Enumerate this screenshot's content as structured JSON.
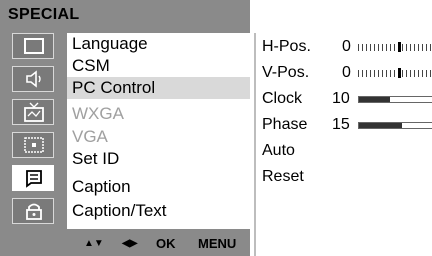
{
  "osd": {
    "title": "SPECIAL",
    "icons": [
      {
        "name": "picture-icon",
        "active": false
      },
      {
        "name": "sound-icon",
        "active": false
      },
      {
        "name": "tv-icon",
        "active": false
      },
      {
        "name": "screen-icon",
        "active": false
      },
      {
        "name": "special-icon",
        "active": true
      },
      {
        "name": "lock-icon",
        "active": false
      }
    ],
    "menu": [
      {
        "label": "Language",
        "state": "normal"
      },
      {
        "label": "CSM",
        "state": "normal"
      },
      {
        "label": "PC Control",
        "state": "selected"
      },
      {
        "label": "WXGA",
        "state": "disabled"
      },
      {
        "label": "VGA",
        "state": "disabled"
      },
      {
        "label": "Set ID",
        "state": "normal"
      },
      {
        "label": "Caption",
        "state": "normal"
      },
      {
        "label": "Caption/Text",
        "state": "normal"
      }
    ],
    "nav": {
      "updown": "▲▼",
      "leftright": "◀▶",
      "ok": "OK",
      "menu": "MENU"
    }
  },
  "submenu": {
    "rows": [
      {
        "label": "H-Pos.",
        "value": "0",
        "control": "ticks",
        "level": 0.5
      },
      {
        "label": "V-Pos.",
        "value": "0",
        "control": "ticks",
        "level": 0.5
      },
      {
        "label": "Clock",
        "value": "10",
        "control": "bar",
        "level": 0.4
      },
      {
        "label": "Phase",
        "value": "15",
        "control": "bar",
        "level": 0.55
      },
      {
        "label": "Auto",
        "value": "",
        "control": "none"
      },
      {
        "label": "Reset",
        "value": "",
        "control": "none"
      }
    ]
  }
}
